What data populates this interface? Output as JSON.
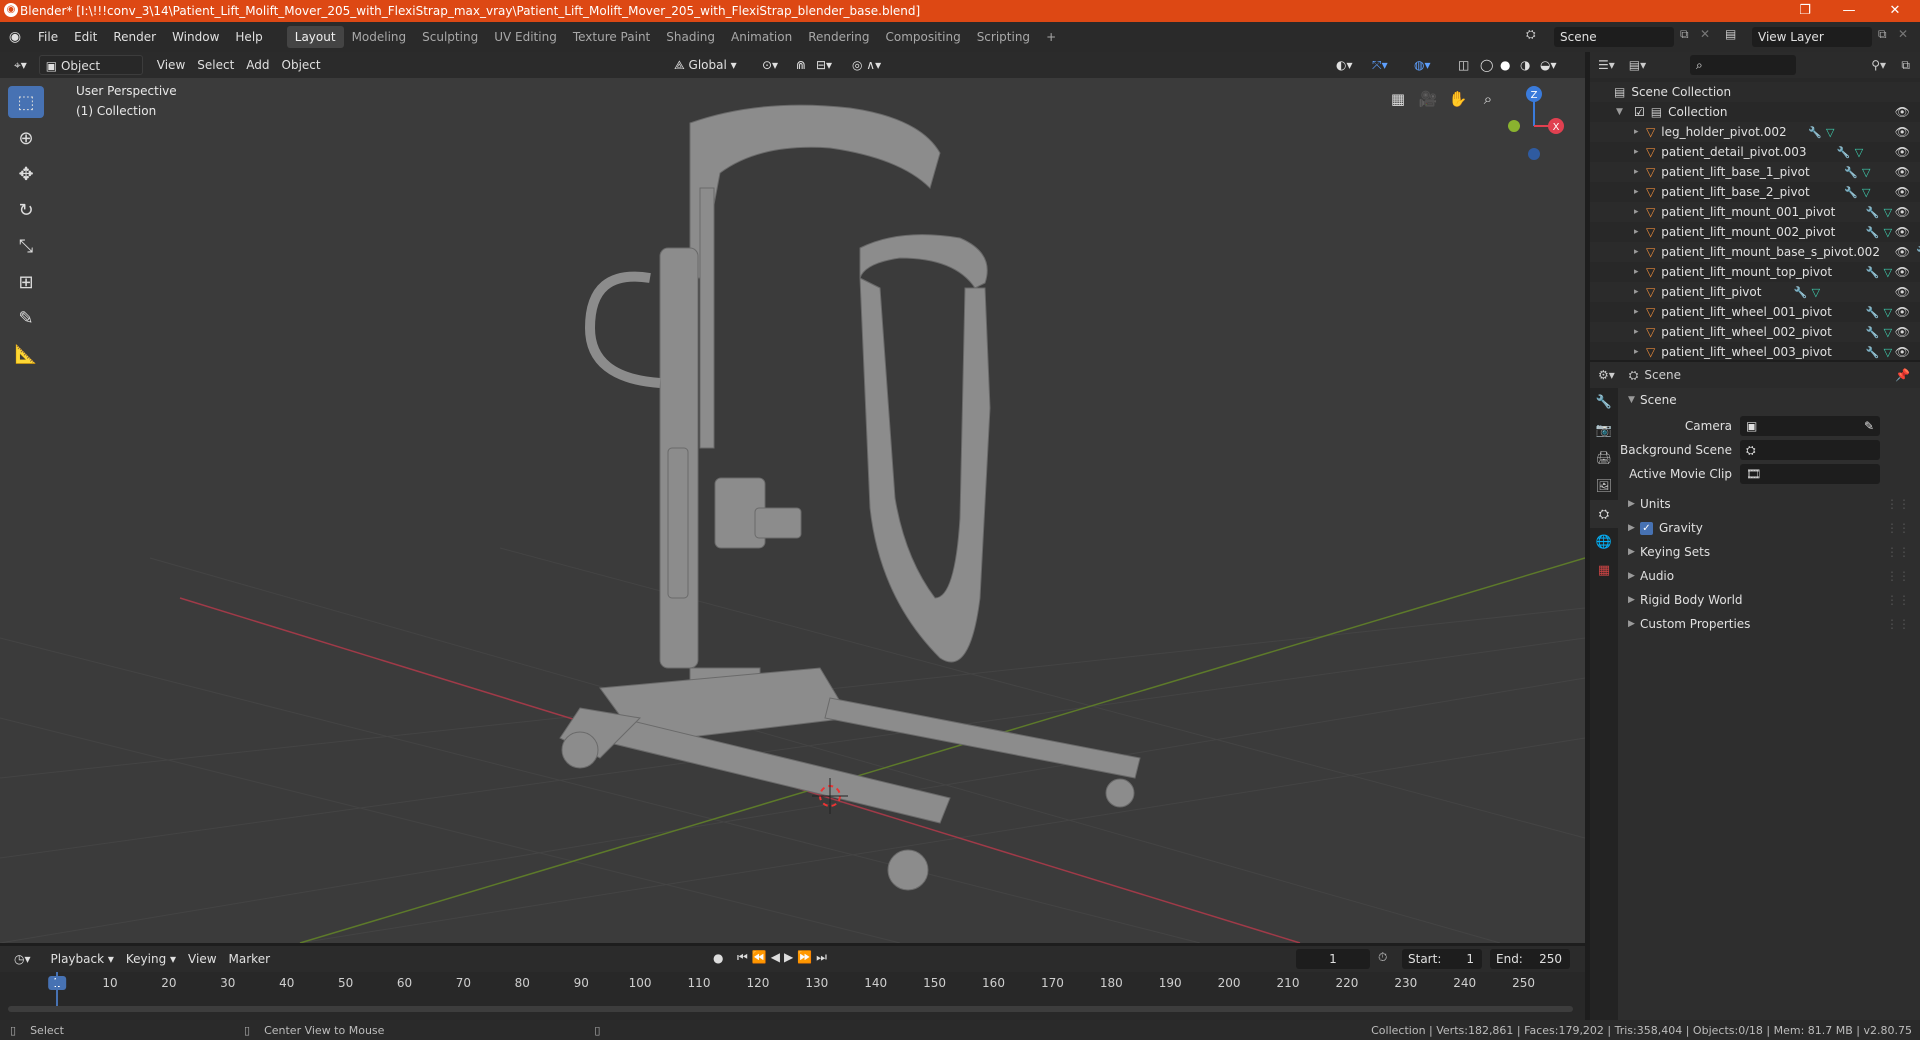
{
  "title": "Blender* [I:\\!!!conv_3\\14\\Patient_Lift_Molift_Mover_205_with_FlexiStrap_max_vray\\Patient_Lift_Molift_Mover_205_with_FlexiStrap_blender_base.blend]",
  "window_controls": {
    "minimize": "—",
    "maximize": "❐",
    "close": "✕"
  },
  "menu": [
    "File",
    "Edit",
    "Render",
    "Window",
    "Help"
  ],
  "workspaces": [
    "Layout",
    "Modeling",
    "Sculpting",
    "UV Editing",
    "Texture Paint",
    "Shading",
    "Animation",
    "Rendering",
    "Compositing",
    "Scripting"
  ],
  "workspace_add": "+",
  "scene_name": "Scene",
  "view_layer": "View Layer",
  "viewport_header": {
    "mode": "Object Mode",
    "menus": [
      "View",
      "Select",
      "Add",
      "Object"
    ],
    "orientation": "Global"
  },
  "viewport": {
    "label_view": "User Perspective",
    "label_collection": "(1) Collection",
    "gizmo": {
      "z": "Z",
      "x": "X"
    }
  },
  "outliner": {
    "root": "Scene Collection",
    "collection": "Collection",
    "items": [
      "leg_holder_pivot.002",
      "patient_detail_pivot.003",
      "patient_lift_base_1_pivot",
      "patient_lift_base_2_pivot",
      "patient_lift_mount_001_pivot",
      "patient_lift_mount_002_pivot",
      "patient_lift_mount_base_s_pivot.002",
      "patient_lift_mount_top_pivot",
      "patient_lift_pivot",
      "patient_lift_wheel_001_pivot",
      "patient_lift_wheel_002_pivot",
      "patient_lift_wheel_003_pivot"
    ]
  },
  "properties": {
    "context": "Scene",
    "panel_title": "Scene",
    "fields": [
      {
        "label": "Camera"
      },
      {
        "label": "Background Scene"
      },
      {
        "label": "Active Movie Clip"
      }
    ],
    "subpanels": [
      "Units",
      "Gravity",
      "Keying Sets",
      "Audio",
      "Rigid Body World",
      "Custom Properties"
    ]
  },
  "timeline": {
    "menus": [
      "Playback",
      "Keying",
      "View",
      "Marker"
    ],
    "current_frame": "1",
    "start_label": "Start:",
    "start": "1",
    "end_label": "End:",
    "end": "250",
    "ticks": [
      "1",
      "10",
      "20",
      "30",
      "40",
      "50",
      "60",
      "70",
      "80",
      "90",
      "100",
      "110",
      "120",
      "130",
      "140",
      "150",
      "160",
      "170",
      "180",
      "190",
      "200",
      "210",
      "220",
      "230",
      "240",
      "250"
    ]
  },
  "statusbar": {
    "left": "Select",
    "middle": "Center View to Mouse",
    "stats": "Collection | Verts:182,861 | Faces:179,202 | Tris:358,404 | Objects:0/18 | Mem: 81.7 MB | v2.80.75"
  },
  "colors": {
    "accent": "#4772b3",
    "titlebar": "#dd4814",
    "x_axis": "#e04050",
    "y_axis": "#8ab32f",
    "z_axis": "#3a7bdb"
  }
}
